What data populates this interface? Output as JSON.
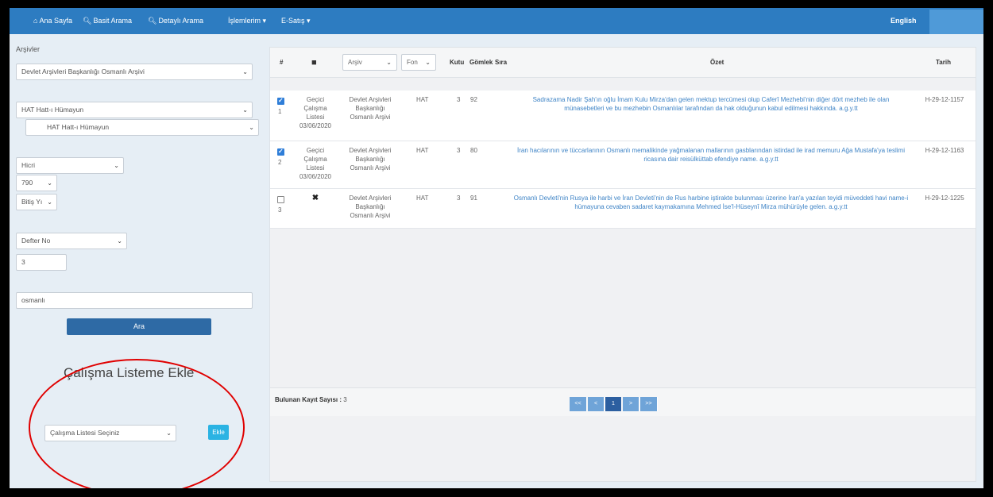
{
  "navbar": {
    "items": [
      {
        "label": "Ana Sayfa",
        "icon": "home-icon"
      },
      {
        "label": "Basit Arama",
        "icon": "search-icon"
      },
      {
        "label": "Detaylı Arama",
        "icon": "search-icon"
      },
      {
        "label": "İşlemlerim ▾"
      },
      {
        "label": "E-Satış ▾"
      }
    ],
    "language_link": "English"
  },
  "search_form": {
    "arsivler_label": "Arşivler",
    "arsiv_select": "Devlet Arşivleri Başkanlığı Osmanlı Arşivi",
    "fon_select": "HAT Hatt-ı Hümayun",
    "alt_fon_select": "HAT Hatt-ı Hümayun",
    "takvim_select": "Hicri",
    "baslangic_yili_select": "790",
    "bitis_yili_select": "Bitiş Yı",
    "numara_turu_select": "Defter No",
    "numara_input": "3",
    "keyword_input": "osmanlı",
    "ara_button": "Ara"
  },
  "work_list": {
    "title": "Çalışma Listeme Ekle",
    "select": "Çalışma Listesi Seçiniz",
    "add_button": "Ekle"
  },
  "results": {
    "columns": {
      "num": "#",
      "arsiv_filter": "Arşiv",
      "fon_filter": "Fon",
      "kutu": "Kutu",
      "gomlek": "Gömlek",
      "sira": "Sıra",
      "ozet": "Özet",
      "tarih": "Tarih"
    },
    "rows": [
      {
        "checked": true,
        "num": "1",
        "list_status": [
          "Geçici",
          "Çalışma",
          "Listesi",
          "03/06/2020"
        ],
        "arsiv": [
          "Devlet Arşivleri",
          "Başkanlığı",
          "Osmanlı Arşivi"
        ],
        "fon": "HAT",
        "kutu": "3",
        "gomlek": "92",
        "ozet": "Sadrazama Nadir Şah'ın oğlu İmam Kulu Mirza'dan gelen mektup tercümesi olup Caferî Mezhebi'nin diğer dört mezheb ile olan münasebetleri ve bu mezhebin Osmanlılar tarafından da hak olduğunun kabul edilmesi hakkında. a.g.y.tt",
        "tarih": "H-29-12-1157"
      },
      {
        "checked": true,
        "num": "2",
        "list_status": [
          "Geçici",
          "Çalışma",
          "Listesi",
          "03/06/2020"
        ],
        "arsiv": [
          "Devlet Arşivleri",
          "Başkanlığı",
          "Osmanlı Arşivi"
        ],
        "fon": "HAT",
        "kutu": "3",
        "gomlek": "80",
        "ozet": "İran hacılarının ve tüccarlarının Osmanlı memalikinde yağmalanan mallarının gasblarından istirdad ile irad memuru Ağa Mustafa'ya teslimi ricasına dair reisülküttab efendiye name. a.g.y.tt",
        "tarih": "H-29-12-1163"
      },
      {
        "checked": false,
        "num": "3",
        "list_status": [
          "✖"
        ],
        "arsiv": [
          "Devlet Arşivleri",
          "Başkanlığı",
          "Osmanlı Arşivi"
        ],
        "fon": "HAT",
        "kutu": "3",
        "gomlek": "91",
        "ozet": "Osmanlı Devleti'nin Rusya ile harbi ve İran Devleti'nin de Rus harbine iştirakte bulunması üzerine İran'a yazılan teyidi müveddeti havi name-i hümayuna cevaben sadaret kaymakamına Mehmed İse'l-Hüseynî Mirza mühürüyle gelen. a.g.y.tt",
        "tarih": "H-29-12-1225"
      }
    ],
    "found_label": "Bulunan Kayıt Sayısı :",
    "found_count": "3",
    "pagination": [
      "<<",
      "<",
      "1",
      ">",
      ">>"
    ]
  },
  "colors": {
    "navbar": "#2d7cc1",
    "primary_button": "#2e6aa5",
    "add_button": "#2bb3e3",
    "ozet_text": "#3f84c6",
    "annotation_ellipse": "#e00000"
  }
}
